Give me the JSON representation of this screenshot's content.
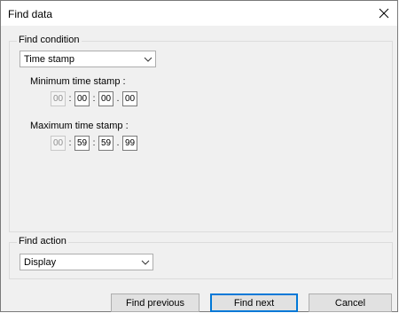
{
  "dialog": {
    "title": "Find data",
    "close_icon": "close-icon"
  },
  "find_condition": {
    "legend": "Find condition",
    "type_selected": "Time stamp",
    "min_label": "Minimum time stamp :",
    "min": [
      "00",
      "00",
      "00",
      "00"
    ],
    "max_label": "Maximum time stamp :",
    "max": [
      "00",
      "59",
      "59",
      "99"
    ],
    "separators": [
      ":",
      ":",
      "."
    ]
  },
  "find_action": {
    "legend": "Find action",
    "selected": "Display"
  },
  "buttons": {
    "find_previous": "Find previous",
    "find_next": "Find next",
    "cancel": "Cancel"
  }
}
